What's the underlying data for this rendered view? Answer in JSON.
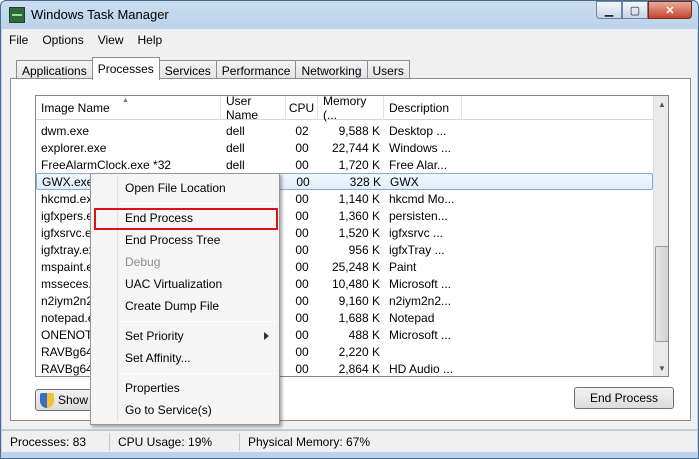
{
  "window": {
    "title": "Windows Task Manager"
  },
  "window_buttons": {
    "minimize": "▁",
    "maximize": "▢",
    "close": "✕"
  },
  "menu": [
    "File",
    "Options",
    "View",
    "Help"
  ],
  "tabs": [
    "Applications",
    "Processes",
    "Services",
    "Performance",
    "Networking",
    "Users"
  ],
  "active_tab": "Processes",
  "columns": [
    "Image Name",
    "User Name",
    "CPU",
    "Memory (...",
    "Description"
  ],
  "rows": [
    [
      "dwm.exe",
      "dell",
      "02",
      "9,588 K",
      "Desktop ..."
    ],
    [
      "explorer.exe",
      "dell",
      "00",
      "22,744 K",
      "Windows ..."
    ],
    [
      "FreeAlarmClock.exe *32",
      "dell",
      "00",
      "1,720 K",
      "Free Alar..."
    ],
    [
      "GWX.exe",
      "",
      "00",
      "328 K",
      "GWX"
    ],
    [
      "hkcmd.exe",
      "",
      "00",
      "1,140 K",
      "hkcmd Mo..."
    ],
    [
      "igfxpers.exe",
      "",
      "00",
      "1,360 K",
      "persisten..."
    ],
    [
      "igfxsrvc.exe",
      "",
      "00",
      "1,520 K",
      "igfxsrvc ..."
    ],
    [
      "igfxtray.exe",
      "",
      "00",
      "956 K",
      "igfxTray ..."
    ],
    [
      "mspaint.exe",
      "",
      "00",
      "25,248 K",
      "Paint"
    ],
    [
      "msseces.exe",
      "",
      "00",
      "10,480 K",
      "Microsoft ..."
    ],
    [
      "n2iym2n2z",
      "",
      "00",
      "9,160 K",
      "n2iym2n2..."
    ],
    [
      "notepad.exe",
      "",
      "00",
      "1,688 K",
      "Notepad"
    ],
    [
      "ONENOTEM",
      "",
      "00",
      "488 K",
      "Microsoft ..."
    ],
    [
      "RAVBg64.exe",
      "",
      "00",
      "2,220 K",
      ""
    ],
    [
      "RAVBg64.exe",
      "",
      "00",
      "2,864 K",
      "HD Audio ..."
    ]
  ],
  "row_display": [
    [
      "dwm.exe",
      "dell",
      "02",
      "9,588 K",
      "Desktop ..."
    ],
    [
      "explorer.exe",
      "dell",
      "00",
      "22,744 K",
      "Windows ..."
    ],
    [
      "FreeAlarmClock.exe *32",
      "dell",
      "00",
      "1,720 K",
      "Free Alar..."
    ],
    [
      "GWX.exe",
      "",
      "00",
      "328 K",
      "GWX"
    ],
    [
      "hkcmd.exe",
      "",
      "00",
      "1,140 K",
      "hkcmd Mo..."
    ],
    [
      "igfxpers.ex",
      "",
      "00",
      "1,360 K",
      "persisten..."
    ],
    [
      "igfxsrvc.ex",
      "",
      "00",
      "1,520 K",
      "igfxsrvc ..."
    ],
    [
      "igfxtray.ex",
      "",
      "00",
      "956 K",
      "igfxTray ..."
    ],
    [
      "mspaint.ex",
      "",
      "00",
      "25,248 K",
      "Paint"
    ],
    [
      "msseces.e",
      "",
      "00",
      "10,480 K",
      "Microsoft ..."
    ],
    [
      "n2iym2n2z",
      "",
      "00",
      "9,160 K",
      "n2iym2n2..."
    ],
    [
      "notepad.ex",
      "",
      "00",
      "1,688 K",
      "Notepad"
    ],
    [
      "ONENOTEM",
      "",
      "00",
      "488 K",
      "Microsoft ..."
    ],
    [
      "RAVBg64.e",
      "",
      "00",
      "2,220 K",
      ""
    ],
    [
      "RAVBg64.e",
      "",
      "00",
      "2,864 K",
      "HD Audio ..."
    ]
  ],
  "selected_row": 3,
  "buttons": {
    "show": "Show p",
    "end_process": "End Process"
  },
  "status": {
    "processes": "Processes: 83",
    "cpu": "CPU Usage: 19%",
    "memory": "Physical Memory: 67%"
  },
  "context_menu": {
    "open_location": "Open File Location",
    "end_process": "End Process",
    "end_tree": "End Process Tree",
    "debug": "Debug",
    "uac": "UAC Virtualization",
    "dump": "Create Dump File",
    "priority": "Set Priority",
    "affinity": "Set Affinity...",
    "properties": "Properties",
    "goto_service": "Go to Service(s)"
  },
  "highlight_color": "#d9121c"
}
